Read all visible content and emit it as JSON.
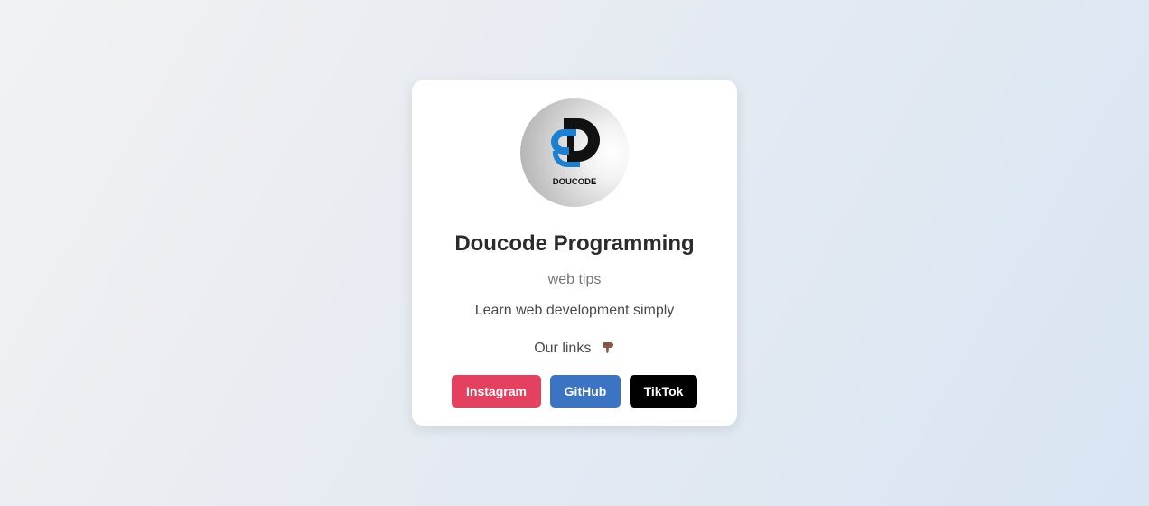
{
  "profile": {
    "logo_text": "DOUCODE",
    "name": "Doucode Programming",
    "tagline": "web tips",
    "description": "Learn web development simply",
    "links_label": "Our links"
  },
  "links": [
    {
      "label": "Instagram",
      "color": "#e4405f",
      "icon": "instagram"
    },
    {
      "label": "GitHub",
      "color": "#3b74c2",
      "icon": "github"
    },
    {
      "label": "TikTok",
      "color": "#000000",
      "icon": "tiktok"
    }
  ],
  "colors": {
    "brand_blue": "#1c7fd0",
    "text_dark": "#2b2b2b",
    "text_muted": "#777777"
  }
}
